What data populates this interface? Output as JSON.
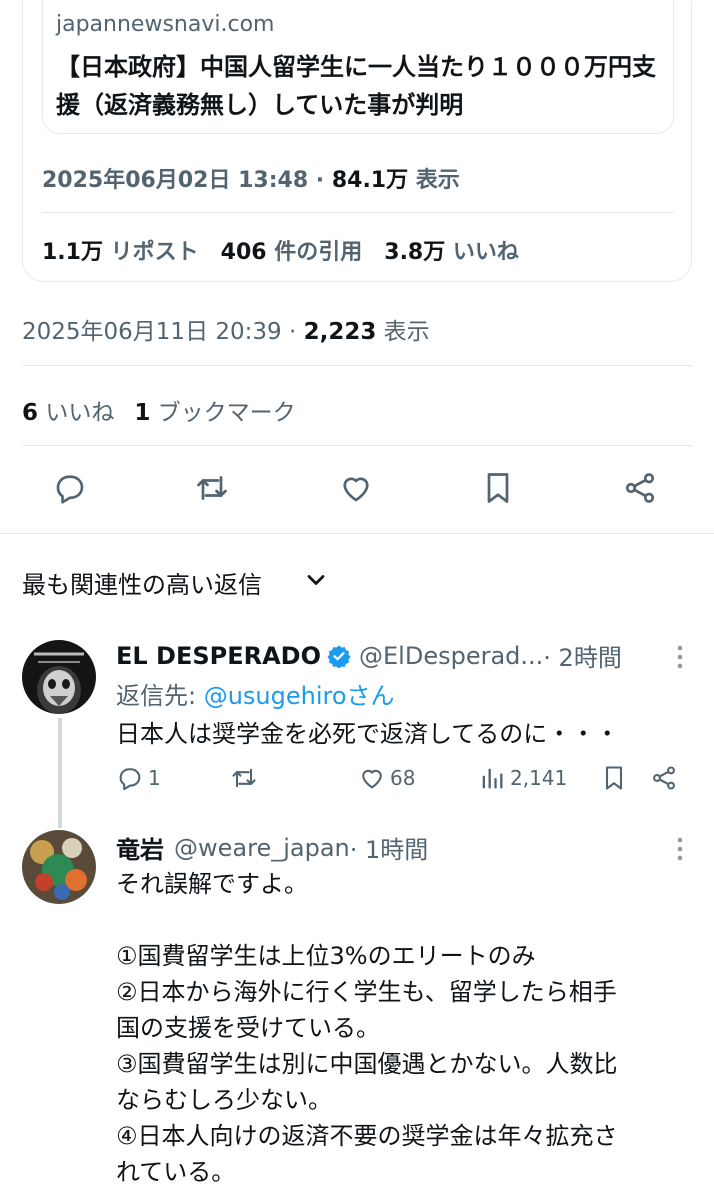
{
  "quoted": {
    "link_domain": "japannewsnavi.com",
    "link_title": "【日本政府】中国人留学生に一人当たり１０００万円支援（返済義務無し）していた事が判明",
    "date": "2025年06月02日 13:48 · ",
    "views_count": "84.1万",
    "views_label": " 表示",
    "reposts_count": "1.1万",
    "reposts_label": " リポスト",
    "quotes_count": "406",
    "quotes_label": " 件の引用",
    "likes_count": "3.8万",
    "likes_label": " いいね"
  },
  "main": {
    "date": "2025年06月11日 20:39 · ",
    "views_count": "2,223",
    "views_label": " 表示",
    "likes_count": "6",
    "likes_label": " いいね",
    "bookmarks_count": "1",
    "bookmarks_label": " ブックマーク",
    "actions": [
      "reply-icon",
      "repost-icon",
      "like-icon",
      "bookmark-icon",
      "share-icon"
    ]
  },
  "sort": {
    "label": "最も関連性の高い返信"
  },
  "replies": [
    {
      "name": "EL DESPERADO",
      "handle": "@ElDesperad...",
      "time": " · 2時間",
      "reply_to_label": "返信先: ",
      "reply_to_mention": "@usugehiroさん",
      "text": "日本人は奨学金を必死で返済してるのに・・・",
      "replies": "1",
      "reposts": "",
      "likes": "68",
      "views": "2,141"
    },
    {
      "name": "竜岩",
      "handle": "@weare_japan",
      "time": " · 1時間",
      "text": "それ誤解ですよ。\n\n①国費留学生は上位3%のエリートのみ\n②日本から海外に行く学生も、留学したら相手\n国の支援を受けている。\n③国費留学生は別に中国優遇とかない。人数比\nならむしろ少ない。\n④日本人向けの返済不要の奨学金は年々拡充さ\nれている。"
    }
  ],
  "colors": {
    "text": "#0f1419",
    "muted": "#536471",
    "accent": "#1d9bf0",
    "border": "#e6e9ec"
  }
}
